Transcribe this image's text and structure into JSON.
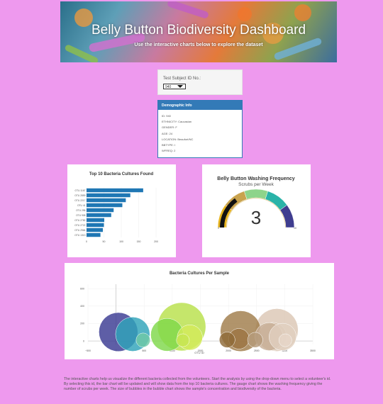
{
  "header": {
    "title": "Belly Button Biodiversity Dashboard",
    "subtitle": "Use the interactive charts below to explore the dataset"
  },
  "selector": {
    "label": "Test Subject ID No.:",
    "selected_value": "940"
  },
  "demographics": {
    "heading": "Demographic Info",
    "rows": [
      "ID: 940",
      "ETHNICITY: Caucasian",
      "GENDER: F",
      "AGE: 24",
      "LOCATION: Beaufort/NC",
      "BBTYPE: I",
      "WFREQ: 2"
    ]
  },
  "colors": {
    "page_background": "#ee99ee",
    "panel_primary": "#337ab7",
    "bar": "#1f77b4",
    "gauge_needle_value": "#444444"
  },
  "chart_data": [
    {
      "type": "bar",
      "orientation": "horizontal",
      "title": "Top 10 Bacteria Cultures Found",
      "categories": [
        "OTU 1167",
        "OTU 2859",
        "OTU 2217",
        "OTU 41",
        "OTU 296",
        "OTU 908",
        "OTU 2782",
        "OTU 2722",
        "OTU 2964",
        "OTU 1313"
      ],
      "values": [
        163,
        126,
        113,
        103,
        78,
        71,
        51,
        50,
        47,
        40
      ],
      "xticks": [
        "0",
        "50",
        "100",
        "150",
        "200"
      ],
      "xlim": [
        0,
        200
      ]
    },
    {
      "type": "gauge",
      "title": "Belly Button Washing Frequency",
      "subtitle": "Scrubs per Week",
      "value": 3,
      "range": [
        0,
        10
      ],
      "min_label": "0",
      "max_label": "10",
      "value_label": "3",
      "band_colors": [
        "#e6b31e",
        "#c9a34e",
        "#8ed48a",
        "#2ab3a8",
        "#3f3d8f"
      ]
    },
    {
      "type": "scatter",
      "subtype": "bubble",
      "title": "Bacteria Cultures Per Sample",
      "xlabel": "OTU ID",
      "xlim": [
        -500,
        3500
      ],
      "ylim": [
        -40,
        650
      ],
      "xticks": [
        "−500",
        "0",
        "500",
        "1000",
        "1500",
        "2000",
        "2500",
        "3000",
        "3500"
      ],
      "yticks": [
        "0",
        "200",
        "400",
        "600"
      ],
      "points": [
        {
          "x": 41,
          "y": 103,
          "size": 103,
          "color": "#3b3a93"
        },
        {
          "x": 296,
          "y": 78,
          "size": 78,
          "color": "#2fa4b9"
        },
        {
          "x": 482,
          "y": 10,
          "size": 10,
          "color": "#6fc8a6"
        },
        {
          "x": 908,
          "y": 71,
          "size": 71,
          "color": "#7fd84a"
        },
        {
          "x": 1167,
          "y": 163,
          "size": 163,
          "color": "#b8e04b"
        },
        {
          "x": 1189,
          "y": 8,
          "size": 8,
          "color": "#c6e552"
        },
        {
          "x": 1313,
          "y": 40,
          "size": 40,
          "color": "#d3ea5a"
        },
        {
          "x": 1977,
          "y": 13,
          "size": 13,
          "color": "#8f6a38"
        },
        {
          "x": 2186,
          "y": 25,
          "size": 25,
          "color": "#9c7443"
        },
        {
          "x": 2217,
          "y": 113,
          "size": 113,
          "color": "#a07c4a"
        },
        {
          "x": 2475,
          "y": 12,
          "size": 12,
          "color": "#b59a7a"
        },
        {
          "x": 2722,
          "y": 50,
          "size": 50,
          "color": "#c8b099"
        },
        {
          "x": 2782,
          "y": 51,
          "size": 51,
          "color": "#d2bba3"
        },
        {
          "x": 2859,
          "y": 126,
          "size": 126,
          "color": "#dcc7b4"
        },
        {
          "x": 2964,
          "y": 47,
          "size": 47,
          "color": "#e1cfbf"
        },
        {
          "x": 3011,
          "y": 8,
          "size": 8,
          "color": "#e6d6c8"
        }
      ]
    }
  ],
  "footer": {
    "description": "The interactive charts help us visualize the different bacteria collected from the volunteers. Start the analysis by using the drop-down menu to select a volunteer's id. By selecting this id, the bar chart will be updated and will show data from the top 10 bacteria cultures. The gauge chart shows the washing frequency giving the number of scrubs per week. The size of bubbles in the bubble chart shows the sample's concentration and biodiversity of the bacteria."
  }
}
